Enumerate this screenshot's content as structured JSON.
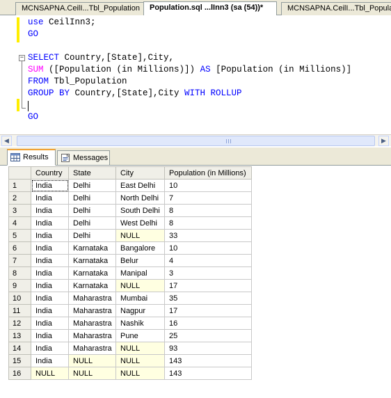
{
  "tabs": [
    {
      "label": "MCNSAPNA.CeilI...Tbl_Population",
      "active": false
    },
    {
      "label": "Population.sql ...lInn3 (sa (54))*",
      "active": true
    },
    {
      "label": "MCNSAPNA.CeilI...Tbl_Population",
      "active": false
    }
  ],
  "editor": {
    "line1": {
      "kw": "use",
      "rest": " CeilInn3;"
    },
    "line2": {
      "kw": "GO"
    },
    "line4": {
      "kw": "SELECT",
      "rest": " Country,[State],City,"
    },
    "line5": {
      "fn": "SUM",
      "rest": " ([Population (in Millions)]) ",
      "kw": "AS",
      "rest2": " [Population (in Millions)]"
    },
    "line6": {
      "kw": "FROM",
      "rest": " Tbl_Population"
    },
    "line7": {
      "kw": "GROUP BY",
      "rest": " Country,[State],City ",
      "kw2": "WITH ROLLUP"
    },
    "line9": {
      "kw": "GO"
    }
  },
  "results_tabs": {
    "results_label": "Results",
    "messages_label": "Messages"
  },
  "grid": {
    "columns": [
      "",
      "Country",
      "State",
      "City",
      "Population (in Millions)"
    ],
    "rows": [
      [
        "1",
        "India",
        "Delhi",
        "East Delhi",
        "10"
      ],
      [
        "2",
        "India",
        "Delhi",
        "North Delhi",
        "7"
      ],
      [
        "3",
        "India",
        "Delhi",
        "South Delhi",
        "8"
      ],
      [
        "4",
        "India",
        "Delhi",
        "West Delhi",
        "8"
      ],
      [
        "5",
        "India",
        "Delhi",
        "NULL",
        "33"
      ],
      [
        "6",
        "India",
        "Karnataka",
        "Bangalore",
        "10"
      ],
      [
        "7",
        "India",
        "Karnataka",
        "Belur",
        "4"
      ],
      [
        "8",
        "India",
        "Karnataka",
        "Manipal",
        "3"
      ],
      [
        "9",
        "India",
        "Karnataka",
        "NULL",
        "17"
      ],
      [
        "10",
        "India",
        "Maharastra",
        "Mumbai",
        "35"
      ],
      [
        "11",
        "India",
        "Maharastra",
        "Nagpur",
        "17"
      ],
      [
        "12",
        "India",
        "Maharastra",
        "Nashik",
        "16"
      ],
      [
        "13",
        "India",
        "Maharastra",
        "Pune",
        "25"
      ],
      [
        "14",
        "India",
        "Maharastra",
        "NULL",
        "93"
      ],
      [
        "15",
        "India",
        "NULL",
        "NULL",
        "143"
      ],
      [
        "16",
        "NULL",
        "NULL",
        "NULL",
        "143"
      ]
    ]
  },
  "colors": {
    "keyword": "#0000ff",
    "function": "#ff00ff",
    "null_cell": "#ffffe1",
    "change_bar": "#ffee00"
  },
  "icons": {
    "results_tab": "grid-icon",
    "messages_tab": "messages-icon",
    "scroll_left": "arrow-left-icon",
    "scroll_right": "arrow-right-icon"
  }
}
